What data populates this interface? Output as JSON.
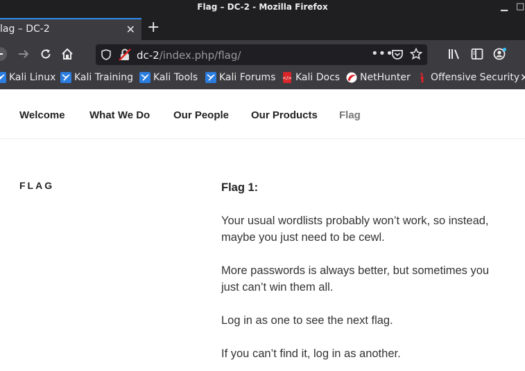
{
  "window": {
    "title": "Flag – DC-2 - Mozilla Firefox"
  },
  "tabs": [
    {
      "label": "lag – DC-2",
      "active": true
    }
  ],
  "url": {
    "host": "dc-2",
    "path": "/index.php/flag/"
  },
  "bookmarks": [
    {
      "label": "Kali Linux",
      "icon": "kali-icon"
    },
    {
      "label": "Kali Training",
      "icon": "kali-icon"
    },
    {
      "label": "Kali Tools",
      "icon": "kali-icon"
    },
    {
      "label": "Kali Forums",
      "icon": "kali-icon"
    },
    {
      "label": "Kali Docs",
      "icon": "kali-docs-icon"
    },
    {
      "label": "NetHunter",
      "icon": "nethunter-icon"
    },
    {
      "label": "Offensive Security",
      "icon": "offsec-icon"
    }
  ],
  "site_nav": [
    {
      "label": "Welcome",
      "current": false
    },
    {
      "label": "What We Do",
      "current": false
    },
    {
      "label": "Our People",
      "current": false
    },
    {
      "label": "Our Products",
      "current": false
    },
    {
      "label": "Flag",
      "current": true
    }
  ],
  "page": {
    "title": "FLAG",
    "heading": "Flag 1:",
    "paragraphs": [
      "Your usual wordlists probably won’t work, so instead, maybe you just need to be cewl.",
      "More passwords is always better, but sometimes you just can’t win them all.",
      "Log in as one to see the next flag.",
      "If you can’t find it, log in as another."
    ]
  },
  "colors": {
    "chrome_dark": "#1f1f22",
    "chrome": "#3c3b40",
    "tab_accent": "#2e8ef0"
  }
}
